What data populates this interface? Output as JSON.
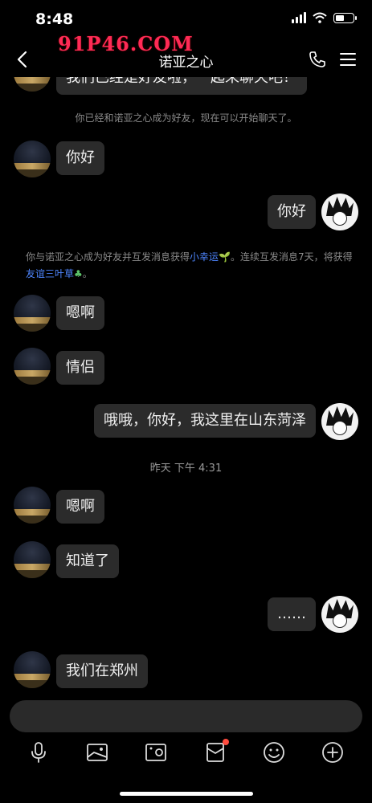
{
  "status_bar": {
    "time": "8:48"
  },
  "header": {
    "title": "诺亚之心",
    "watermark": "91P46.COM"
  },
  "messages": {
    "partial_top": "我们已经是好友啦，一起来聊天吧！",
    "system_friend": "你已经和诺亚之心成为好友，现在可以开始聊天了。",
    "m1": "你好",
    "m2": "你好",
    "system_reward": {
      "part1": "你与诺亚之心成为好友并互发消息获得",
      "link1": "小幸运",
      "part2": "。连续互发消息7天，将获得",
      "link2": "友谊三叶草",
      "part3": "。"
    },
    "m3": "嗯啊",
    "m4": "情侣",
    "m5": "哦哦，你好，我这里在山东菏泽",
    "time_divider": "昨天 下午 4:31",
    "m6": "嗯啊",
    "m7": "知道了",
    "m8": "……",
    "m9": "我们在郑州"
  },
  "icons": {
    "back": "chevron-left-icon",
    "call": "phone-icon",
    "menu": "hamburger-menu-icon",
    "voice": "microphone-icon",
    "image": "image-icon",
    "camera": "camera-icon",
    "redpacket": "red-packet-icon",
    "emoji": "emoji-icon",
    "plus": "plus-icon"
  },
  "colors": {
    "background": "#000000",
    "bubble": "#2b2b2b",
    "link": "#4e86ff",
    "badge": "#ff4b3e"
  }
}
